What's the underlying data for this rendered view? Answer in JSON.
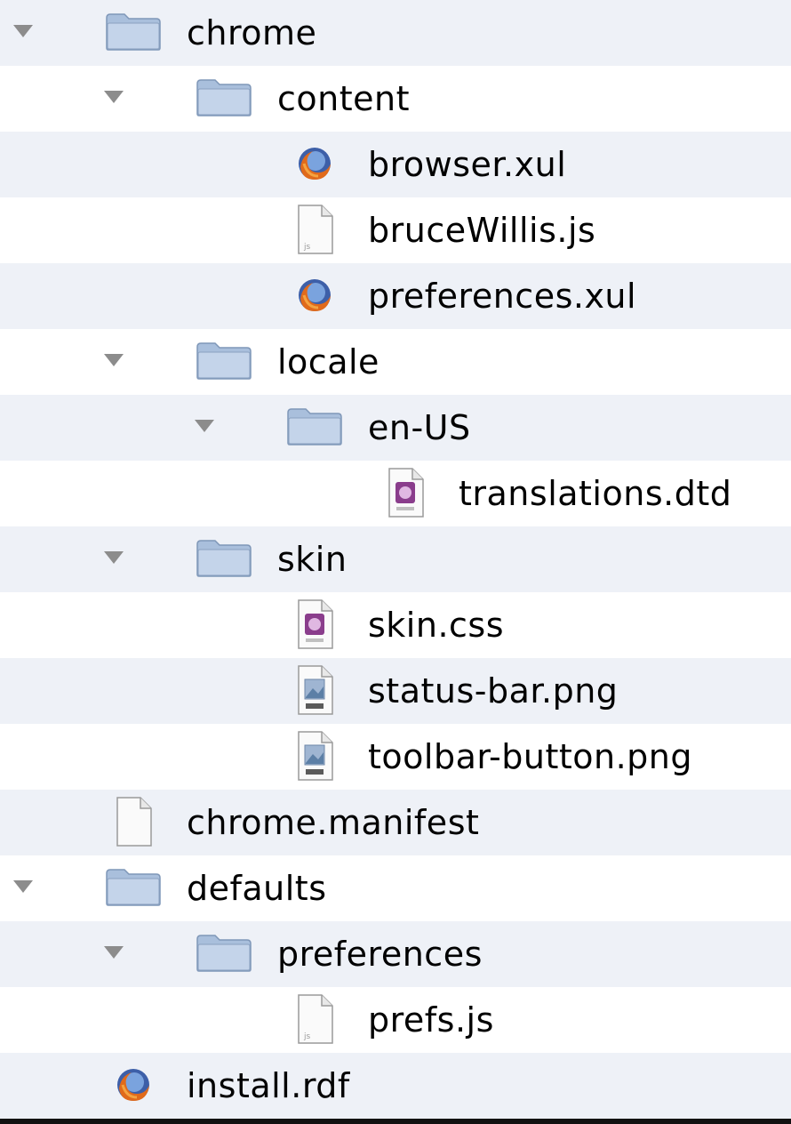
{
  "colors": {
    "row_light": "#eef1f7",
    "row_white": "#ffffff",
    "outer_bg": "#111111",
    "disclosure": "#8c8c8c",
    "folder": "#b9cbe2"
  },
  "tree": [
    {
      "label": "chrome",
      "icon": "folder-icon",
      "depth": 0,
      "expanded": true
    },
    {
      "label": "content",
      "icon": "folder-icon",
      "depth": 1,
      "expanded": true
    },
    {
      "label": "browser.xul",
      "icon": "firefox-document-icon",
      "depth": 2
    },
    {
      "label": "bruceWillis.js",
      "icon": "javascript-file-icon",
      "depth": 2
    },
    {
      "label": "preferences.xul",
      "icon": "firefox-document-icon",
      "depth": 2
    },
    {
      "label": "locale",
      "icon": "folder-icon",
      "depth": 1,
      "expanded": true
    },
    {
      "label": "en-US",
      "icon": "folder-icon",
      "depth": 2,
      "expanded": true
    },
    {
      "label": "translations.dtd",
      "icon": "dtd-file-icon",
      "depth": 3
    },
    {
      "label": "skin",
      "icon": "folder-icon",
      "depth": 1,
      "expanded": true
    },
    {
      "label": "skin.css",
      "icon": "css-file-icon",
      "depth": 2
    },
    {
      "label": "status-bar.png",
      "icon": "image-file-icon",
      "depth": 2
    },
    {
      "label": "toolbar-button.png",
      "icon": "image-file-icon",
      "depth": 2
    },
    {
      "label": "chrome.manifest",
      "icon": "blank-document-icon",
      "depth": 0
    },
    {
      "label": "defaults",
      "icon": "folder-icon",
      "depth": 0,
      "expanded": true
    },
    {
      "label": "preferences",
      "icon": "folder-icon",
      "depth": 1,
      "expanded": true
    },
    {
      "label": "prefs.js",
      "icon": "javascript-file-icon",
      "depth": 2
    },
    {
      "label": "install.rdf",
      "icon": "firefox-document-icon",
      "depth": 0
    }
  ]
}
